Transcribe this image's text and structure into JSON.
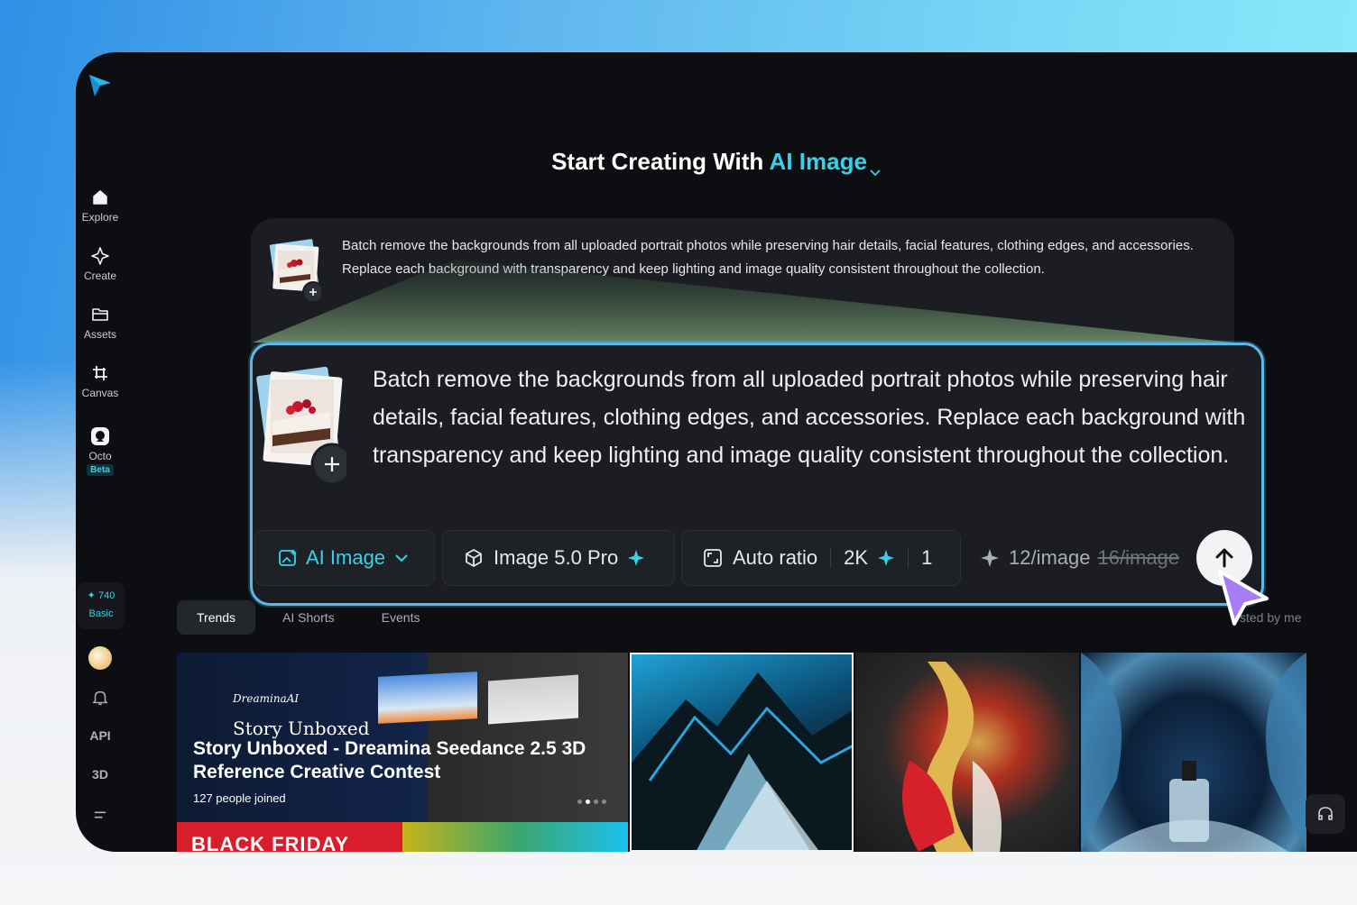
{
  "heading": {
    "prefix": "Start Creating With ",
    "accent": "AI Image"
  },
  "sidebar": {
    "items": [
      {
        "label": "Explore",
        "icon": "home-icon"
      },
      {
        "label": "Create",
        "icon": "sparkle-icon"
      },
      {
        "label": "Assets",
        "icon": "folder-icon"
      },
      {
        "label": "Canvas",
        "icon": "crop-icon"
      },
      {
        "label": "Octo",
        "icon": "octo-icon",
        "badge": "Beta"
      }
    ],
    "credits": "740",
    "plan": "Basic",
    "api_label": "API",
    "three_d_label": "3D"
  },
  "prompt_small": {
    "text": "Batch remove the backgrounds from all uploaded portrait photos while preserving hair details, facial features, clothing edges, and accessories. Replace each background with transparency and keep lighting and image quality consistent throughout the collection."
  },
  "prompt_big": {
    "text": "Batch remove the backgrounds from all uploaded portrait photos while preserving hair details, facial features, clothing edges, and accessories. Replace each background with transparency and keep lighting and image quality consistent throughout the collection."
  },
  "toolbar": {
    "mode": "AI Image",
    "model": "Image 5.0 Pro",
    "ratio": "Auto ratio",
    "resolution": "2K",
    "count": "1",
    "price": "12/image",
    "old_price": "16/image"
  },
  "tabs": [
    "Trends",
    "AI Shorts",
    "Events"
  ],
  "trusted_label": "sted by me",
  "gallery": {
    "feature": {
      "brand": "DreaminaAI",
      "subtitle": "Story Unboxed",
      "title": "Story Unboxed - Dreamina Seedance 2.5 3D Reference Creative Contest",
      "joined": "127 people joined",
      "banner": "BLACK FRIDAY"
    }
  },
  "colors": {
    "accent": "#36d3e8",
    "highlight_border": "#5bb8e8",
    "app_bg": "#0d0e11",
    "card_bg": "#1b1d22"
  }
}
